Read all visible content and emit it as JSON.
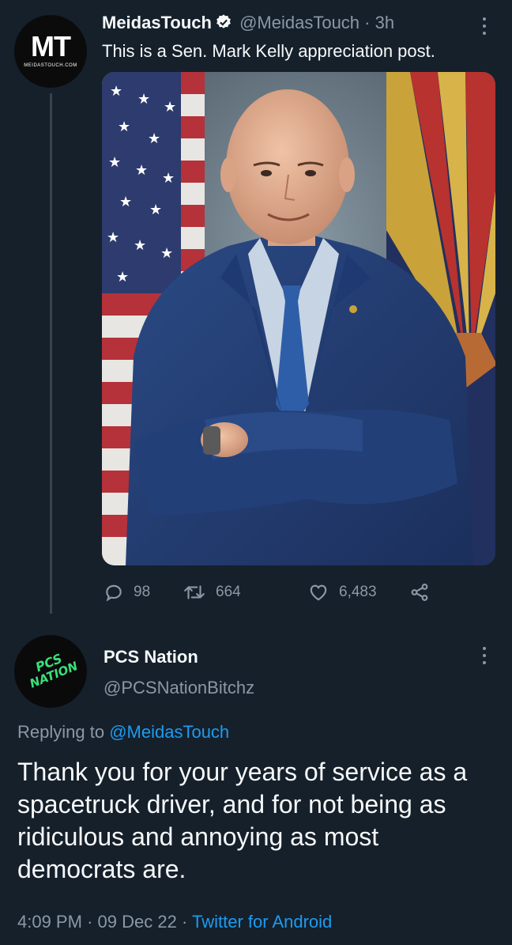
{
  "tweet1": {
    "avatar_text": "MT",
    "avatar_subtext": "MEIDASTOUCH.COM",
    "display_name": "MeidasTouch",
    "handle": "@MeidasTouch",
    "separator": "·",
    "time": "3h",
    "text": "This is a Sen. Mark Kelly appreciation post.",
    "image_alt": "Portrait photo of a man in a navy suit and blue tie, arms crossed, in front of US and Arizona flags",
    "replies": "98",
    "retweets": "664",
    "likes": "6,483"
  },
  "tweet2": {
    "avatar_text_line1": "PCS",
    "avatar_text_line2": "NATION",
    "display_name": "PCS Nation",
    "handle": "@PCSNationBitchz",
    "replying_prefix": "Replying to",
    "replying_mention": "@MeidasTouch",
    "body": "Thank you for your years of service as a spacetruck driver, and for not being as ridiculous and annoying as most democrats are.",
    "time": "4:09 PM",
    "dot1": "·",
    "date": "09 Dec 22",
    "dot2": "·",
    "client": "Twitter for Android"
  },
  "colors": {
    "background": "#15202b",
    "primary_text": "#f7f9f9",
    "secondary_text": "#8b98a5",
    "accent": "#1d9bf0",
    "thread_line": "#38444d"
  },
  "icons": [
    "verified-badge-icon",
    "more-icon",
    "reply-icon",
    "retweet-icon",
    "like-icon",
    "share-icon"
  ]
}
